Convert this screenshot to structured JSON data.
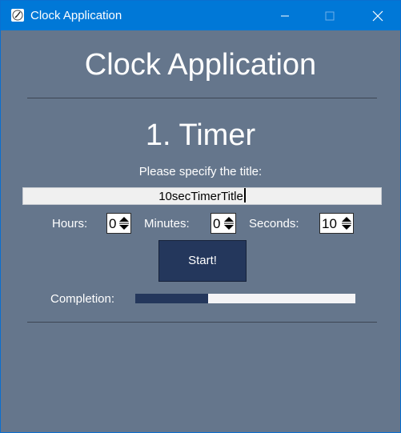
{
  "window": {
    "title": "Clock Application",
    "icon": "clock-icon",
    "controls": [
      "minimize-icon",
      "maximize-icon",
      "close-icon"
    ]
  },
  "main": {
    "app_heading": "Clock Application",
    "section_heading": "1. Timer",
    "title_prompt": "Please specify the title:",
    "title_value": "10secTimerTitle",
    "hours_label": "Hours:",
    "hours_value": "0",
    "minutes_label": "Minutes:",
    "minutes_value": "0",
    "seconds_label": "Seconds:",
    "seconds_value": "10",
    "start_label": "Start!",
    "completion_label": "Completion:",
    "completion_fraction": 0.33
  },
  "colors": {
    "titlebar": "#0078d7",
    "background": "#65768c",
    "accent": "#24375c"
  }
}
